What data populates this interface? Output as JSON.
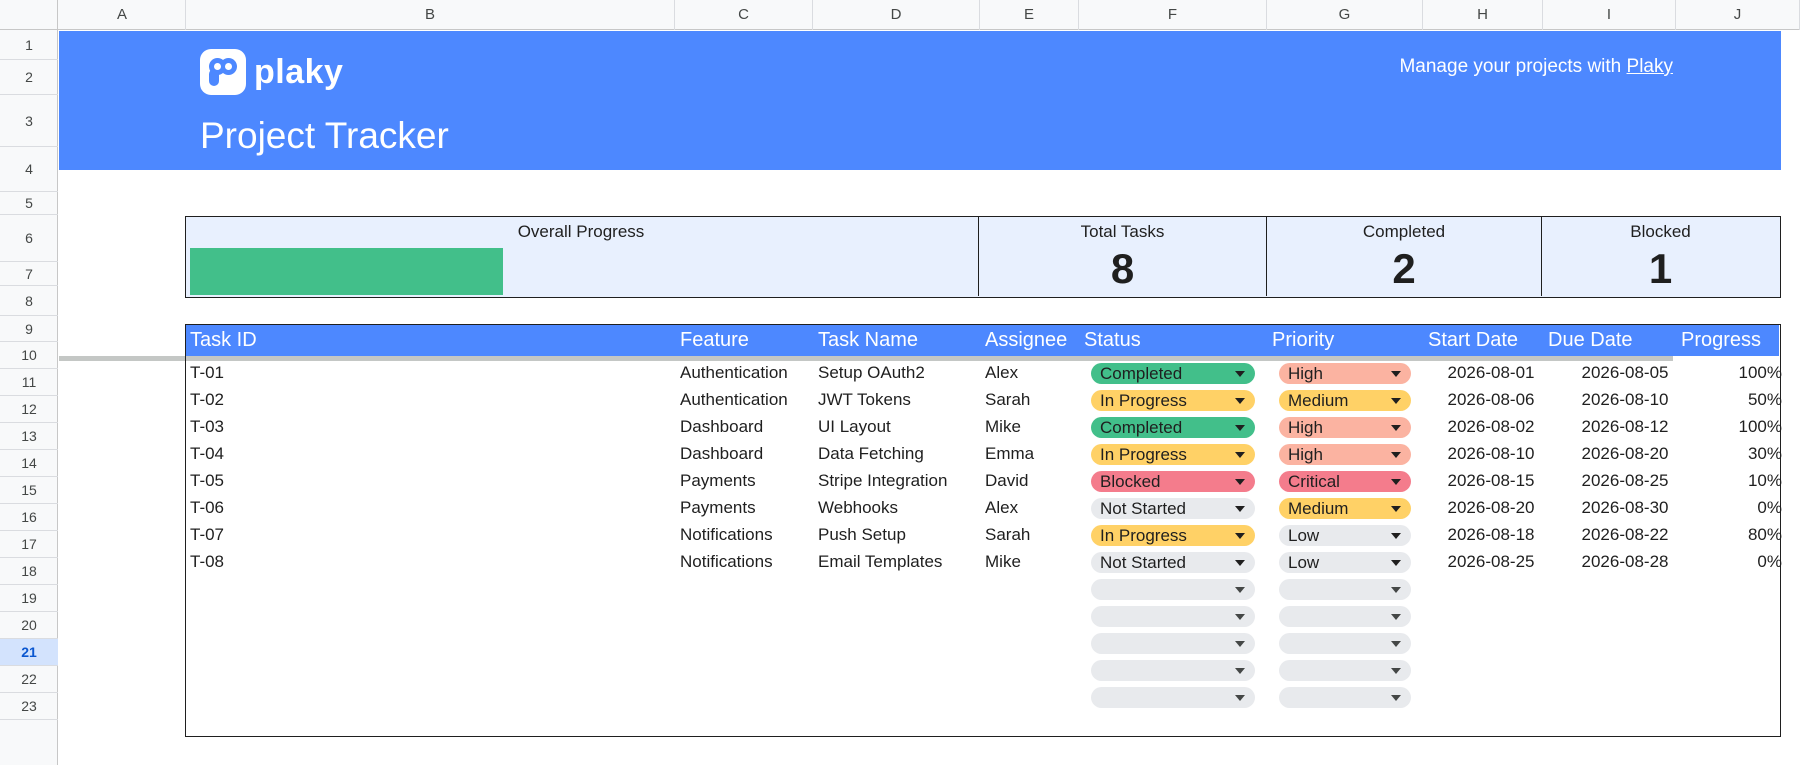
{
  "columns": [
    "A",
    "B",
    "C",
    "D",
    "E",
    "F",
    "G",
    "H",
    "I",
    "J"
  ],
  "rows": [
    "1",
    "2",
    "3",
    "4",
    "5",
    "6",
    "7",
    "8",
    "9",
    "10",
    "11",
    "12",
    "13",
    "14",
    "15",
    "16",
    "17",
    "18",
    "19",
    "20",
    "21",
    "22",
    "23"
  ],
  "active_row": "21",
  "banner": {
    "logo_text": "plaky",
    "tagline_prefix": "Manage your projects with",
    "tagline_link": "Plaky",
    "title": "Project Tracker"
  },
  "summary": {
    "overall_progress_label": "Overall Progress",
    "overall_progress_value": 0.4,
    "total_tasks_label": "Total Tasks",
    "total_tasks_value": "8",
    "completed_label": "Completed",
    "completed_value": "2",
    "blocked_label": "Blocked",
    "blocked_value": "1"
  },
  "table": {
    "headers": [
      "Task ID",
      "Feature",
      "Task Name",
      "Assignee",
      "Status",
      "Priority",
      "Start Date",
      "Due Date",
      "Progress"
    ],
    "tasks": [
      {
        "id": "T-01",
        "feature": "Authentication",
        "name": "Setup OAuth2",
        "assignee": "Alex",
        "status": "Completed",
        "priority": "High",
        "start": "2026-08-01",
        "due": "2026-08-05",
        "progress": "100%"
      },
      {
        "id": "T-02",
        "feature": "Authentication",
        "name": "JWT Tokens",
        "assignee": "Sarah",
        "status": "In Progress",
        "priority": "Medium",
        "start": "2026-08-06",
        "due": "2026-08-10",
        "progress": "50%"
      },
      {
        "id": "T-03",
        "feature": "Dashboard",
        "name": "UI Layout",
        "assignee": "Mike",
        "status": "Completed",
        "priority": "High",
        "start": "2026-08-02",
        "due": "2026-08-12",
        "progress": "100%"
      },
      {
        "id": "T-04",
        "feature": "Dashboard",
        "name": "Data Fetching",
        "assignee": "Emma",
        "status": "In Progress",
        "priority": "High",
        "start": "2026-08-10",
        "due": "2026-08-20",
        "progress": "30%"
      },
      {
        "id": "T-05",
        "feature": "Payments",
        "name": "Stripe Integration",
        "assignee": "David",
        "status": "Blocked",
        "priority": "Critical",
        "start": "2026-08-15",
        "due": "2026-08-25",
        "progress": "10%"
      },
      {
        "id": "T-06",
        "feature": "Payments",
        "name": "Webhooks",
        "assignee": "Alex",
        "status": "Not Started",
        "priority": "Medium",
        "start": "2026-08-20",
        "due": "2026-08-30",
        "progress": "0%"
      },
      {
        "id": "T-07",
        "feature": "Notifications",
        "name": "Push Setup",
        "assignee": "Sarah",
        "status": "In Progress",
        "priority": "Low",
        "start": "2026-08-18",
        "due": "2026-08-22",
        "progress": "80%"
      },
      {
        "id": "T-08",
        "feature": "Notifications",
        "name": "Email Templates",
        "assignee": "Mike",
        "status": "Not Started",
        "priority": "Low",
        "start": "2026-08-25",
        "due": "2026-08-28",
        "progress": "0%"
      }
    ],
    "empty_dropdown_rows": 5
  },
  "status_colors": {
    "Completed": "#42bf8a",
    "In Progress": "#ffd166",
    "Blocked": "#f47c8c",
    "Not Started": "#e8eaed",
    "empty": "#e8eaed"
  },
  "priority_colors": {
    "High": "#fbb3a1",
    "Medium": "#ffd166",
    "Critical": "#f47c8c",
    "Low": "#e8eaed",
    "empty": "#e8eaed"
  },
  "colors": {
    "banner": "#4d88ff",
    "summary_bg": "#e8f0fe",
    "progress_fill": "#42bf8a"
  }
}
